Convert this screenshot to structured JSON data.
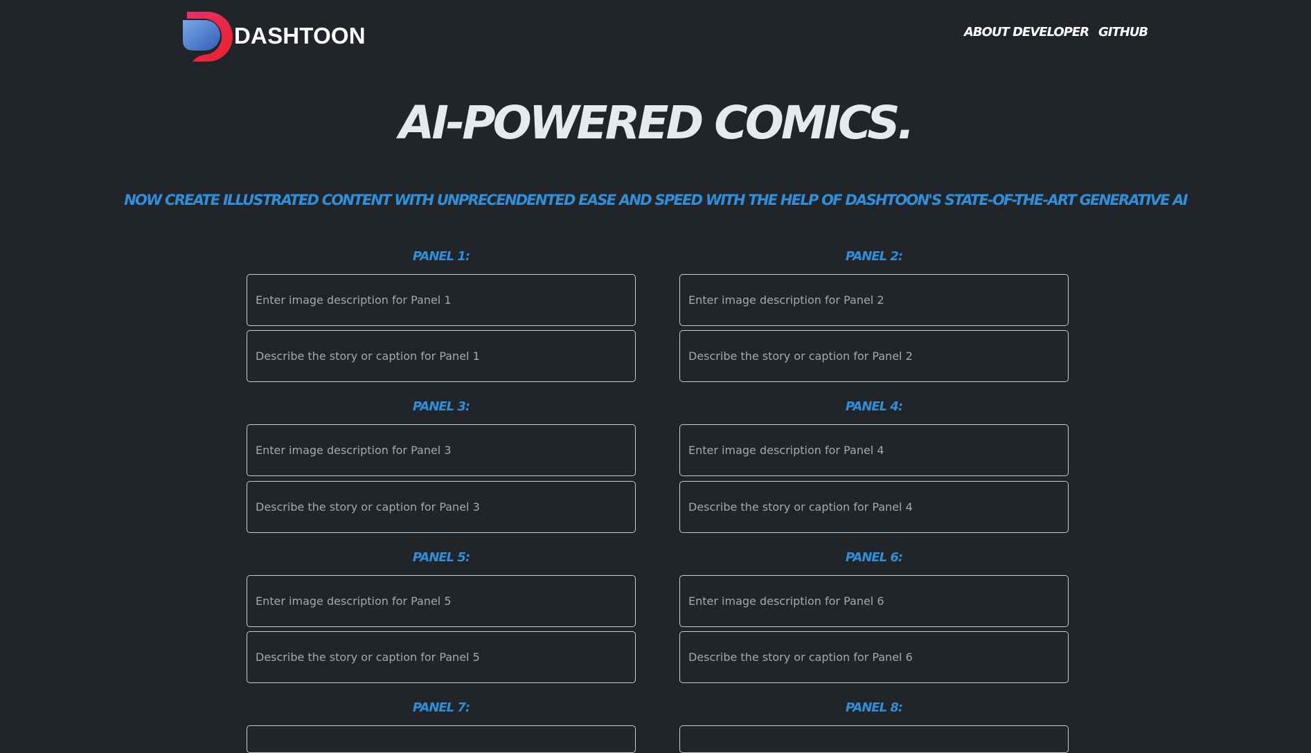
{
  "brand": {
    "name": "DASHTOON"
  },
  "nav": {
    "about": "About Developer",
    "github": "Github"
  },
  "hero": {
    "title": "AI-Powered Comics.",
    "subtitle": "Now create illustrated content with unprecendented ease and speed with the help of Dashtoon's state-of-the-art Generative AI"
  },
  "panels": [
    {
      "label": "Panel 1:",
      "image_placeholder": "Enter image description for Panel 1",
      "caption_placeholder": "Describe the story or caption for Panel 1"
    },
    {
      "label": "Panel 2:",
      "image_placeholder": "Enter image description for Panel 2",
      "caption_placeholder": "Describe the story or caption for Panel 2"
    },
    {
      "label": "Panel 3:",
      "image_placeholder": "Enter image description for Panel 3",
      "caption_placeholder": "Describe the story or caption for Panel 3"
    },
    {
      "label": "Panel 4:",
      "image_placeholder": "Enter image description for Panel 4",
      "caption_placeholder": "Describe the story or caption for Panel 4"
    },
    {
      "label": "Panel 5:",
      "image_placeholder": "Enter image description for Panel 5",
      "caption_placeholder": "Describe the story or caption for Panel 5"
    },
    {
      "label": "Panel 6:",
      "image_placeholder": "Enter image description for Panel 6",
      "caption_placeholder": "Describe the story or caption for Panel 6"
    },
    {
      "label": "Panel 7:"
    },
    {
      "label": "Panel 8:"
    }
  ],
  "colors": {
    "background": "#212429",
    "accent": "#2f8fd8",
    "title": "#e6e9ef",
    "field_border": "#c9cdd3",
    "placeholder": "#a4a9b1"
  }
}
